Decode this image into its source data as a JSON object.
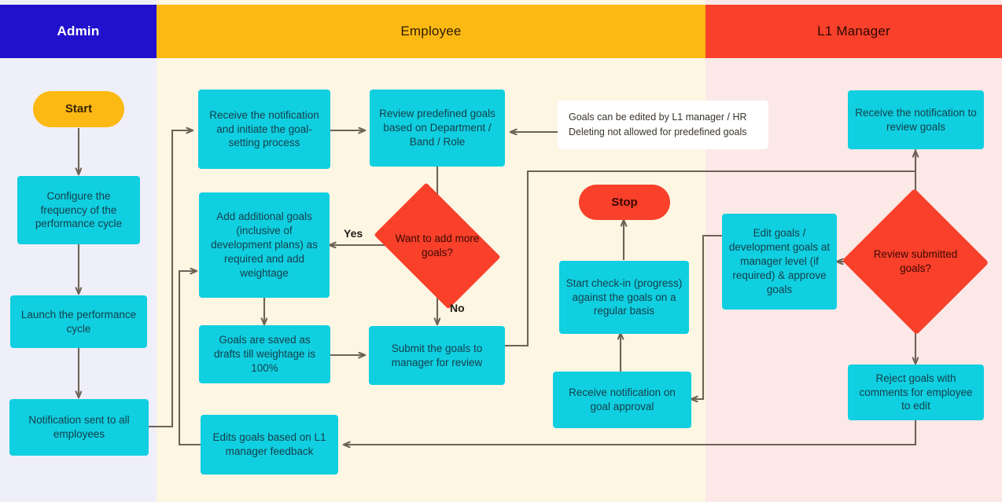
{
  "diagram": {
    "title": "Goal Setting Process Swimlane Flowchart",
    "colors": {
      "admin_header_bg": "#2111CC",
      "admin_lane_bg": "#EFEFFA",
      "employee_header_bg": "#FDB913",
      "employee_lane_bg": "#FDF6E3",
      "manager_header_bg": "#F8402A",
      "manager_lane_bg": "#FCE9E7",
      "process_box": "#10CFE0",
      "decision": "#F8402A",
      "start": "#FDB913",
      "stop": "#F8402A",
      "connector": "#6F6257",
      "note_bg": "#FFFFFF"
    }
  },
  "lanes": [
    {
      "id": "admin",
      "label": "Admin"
    },
    {
      "id": "employee",
      "label": "Employee"
    },
    {
      "id": "manager",
      "label": "L1 Manager"
    }
  ],
  "nodes": {
    "start": "Start",
    "stop": "Stop",
    "admin_configure": "Configure the frequency of the performance cycle",
    "admin_launch": "Launch the performance cycle",
    "admin_notify": "Notification sent to all employees",
    "emp_receive": "Receive the notification and initiate the goal-setting process",
    "emp_review_predefined": "Review predefined goals based on Department / Band / Role",
    "emp_add_goals": "Add additional goals (inclusive of development plans) as required and add weightage",
    "emp_drafts": "Goals are saved as drafts till weightage is 100%",
    "emp_submit": "Submit the goals to manager for review",
    "emp_edits": "Edits goals based on L1 manager feedback",
    "emp_checkin": "Start check-in (progress) against the goals on a regular basis",
    "emp_receive_approval": "Receive notification on goal approval",
    "mgr_receive": "Receive the notification to review goals",
    "mgr_edit_approve": "Edit goals / development goals at manager level (if required) & approve goals",
    "mgr_reject": "Reject goals with comments for employee to edit"
  },
  "decisions": {
    "emp_want_more": "Want to add more goals?",
    "mgr_review": "Review submitted goals?"
  },
  "edge_labels": {
    "yes": "Yes",
    "no": "No"
  },
  "note": {
    "line1": "Goals can be edited by L1 manager / HR",
    "line2": "Deleting not allowed for predefined goals"
  }
}
